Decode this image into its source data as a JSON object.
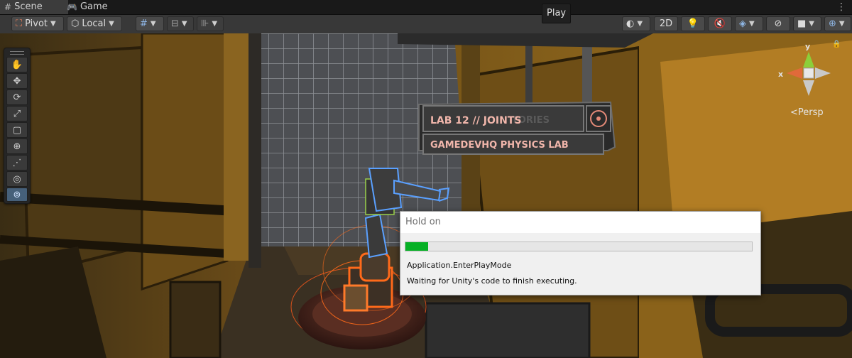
{
  "tabs": [
    {
      "label": "Scene",
      "icon": "grid-icon",
      "active": true
    },
    {
      "label": "Game",
      "icon": "gamepad-icon",
      "active": false
    }
  ],
  "tooltip": {
    "label": "Play"
  },
  "toolbar": {
    "pivot_label": "Pivot",
    "local_label": "Local",
    "mode_2d_label": "2D"
  },
  "tools": [
    {
      "name": "hand",
      "glyph": "✋"
    },
    {
      "name": "move",
      "glyph": "✥"
    },
    {
      "name": "rotate",
      "glyph": "⟳"
    },
    {
      "name": "scale",
      "glyph": "⤢"
    },
    {
      "name": "rect",
      "glyph": "▢"
    },
    {
      "name": "transform",
      "glyph": "⊕"
    },
    {
      "name": "custom",
      "glyph": "⋰"
    },
    {
      "name": "custom-2",
      "glyph": "◎"
    },
    {
      "name": "custom-3",
      "glyph": "⊚"
    }
  ],
  "gizmo": {
    "y_label": "y",
    "x_label": "x",
    "projection_label": "<Persp"
  },
  "scene": {
    "sign_line_1": "LAB 12 // JOINTS",
    "sign_line_1_overlap": "TORIES",
    "sign_line_2": "GAMEDEVHQ PHYSICS LAB"
  },
  "dialog": {
    "title": "Hold on",
    "progress": 0.065,
    "line1": "Application.EnterPlayMode",
    "line2": "Waiting for Unity's code to finish executing."
  },
  "colors": {
    "accent": "#46607a",
    "progress": "#06b025",
    "sign_text": "#f1b6ab",
    "selection_orange": "#ff6a1a"
  }
}
